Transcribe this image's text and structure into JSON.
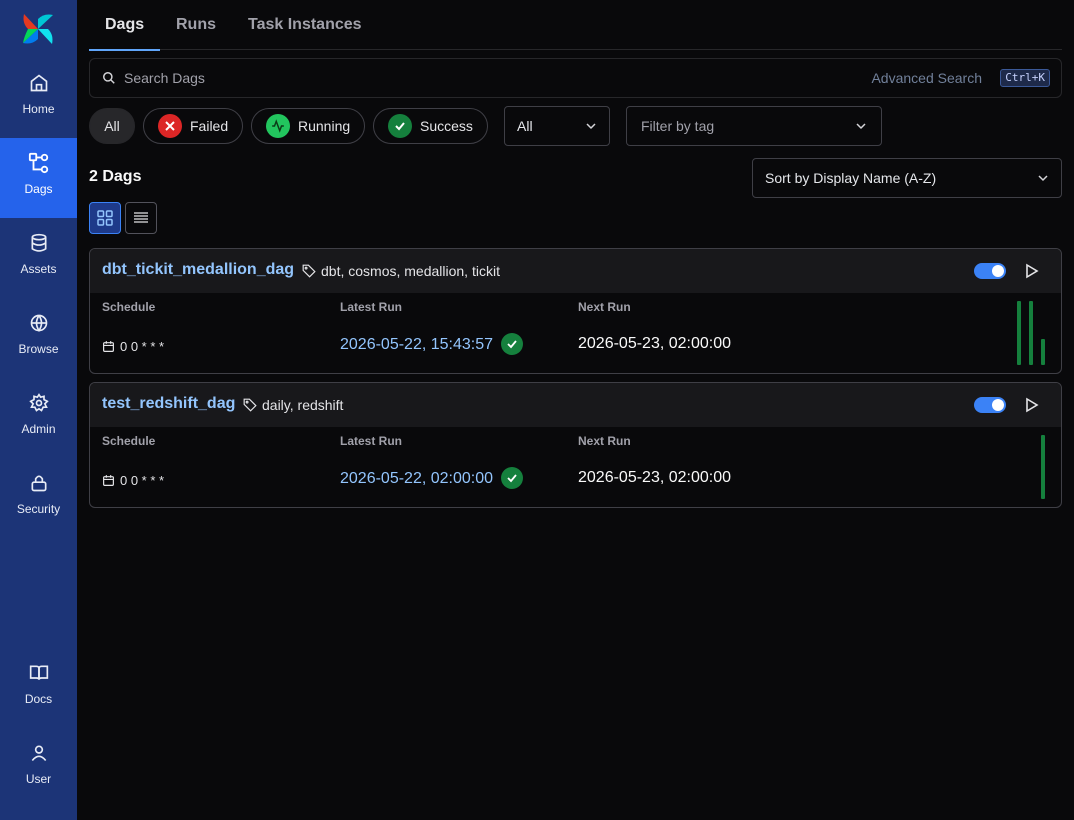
{
  "sidebar": {
    "items": [
      {
        "label": "Home",
        "icon": "home-icon"
      },
      {
        "label": "Dags",
        "icon": "dags-icon",
        "active": true
      },
      {
        "label": "Assets",
        "icon": "database-icon"
      },
      {
        "label": "Browse",
        "icon": "globe-icon"
      },
      {
        "label": "Admin",
        "icon": "gear-icon"
      },
      {
        "label": "Security",
        "icon": "lock-icon"
      },
      {
        "label": "Docs",
        "icon": "book-icon"
      },
      {
        "label": "User",
        "icon": "user-icon"
      }
    ]
  },
  "tabs": [
    {
      "label": "Dags",
      "active": true
    },
    {
      "label": "Runs"
    },
    {
      "label": "Task Instances"
    }
  ],
  "search": {
    "placeholder": "Search Dags",
    "advanced_label": "Advanced Search",
    "shortcut": "Ctrl+K"
  },
  "filters": {
    "state_pills": [
      {
        "label": "All"
      },
      {
        "label": "Failed",
        "color": "#dc2626"
      },
      {
        "label": "Running",
        "color": "#22c55e"
      },
      {
        "label": "Success",
        "color": "#15803d"
      }
    ],
    "active_select": "All",
    "tag_placeholder": "Filter by tag"
  },
  "summary": {
    "count_label": "2 Dags",
    "sort_label": "Sort by Display Name (A-Z)"
  },
  "columns": {
    "schedule": "Schedule",
    "latest_run": "Latest Run",
    "next_run": "Next Run"
  },
  "dags": [
    {
      "name": "dbt_tickit_medallion_dag",
      "tags": "dbt, cosmos, medallion, tickit",
      "schedule": "0 0 * * *",
      "latest_run": "2026-05-22, 15:43:57",
      "latest_state": "success",
      "next_run": "2026-05-23, 02:00:00",
      "enabled": true,
      "recent_runs": [
        "success",
        "success",
        "success"
      ]
    },
    {
      "name": "test_redshift_dag",
      "tags": "daily, redshift",
      "schedule": "0 0 * * *",
      "latest_run": "2026-05-22, 02:00:00",
      "latest_state": "success",
      "next_run": "2026-05-23, 02:00:00",
      "enabled": true,
      "recent_runs": [
        "success"
      ]
    }
  ],
  "colors": {
    "sidebar": "#1c3477",
    "accent": "#2563eb",
    "success": "#15803d",
    "link": "#93c5fd"
  }
}
